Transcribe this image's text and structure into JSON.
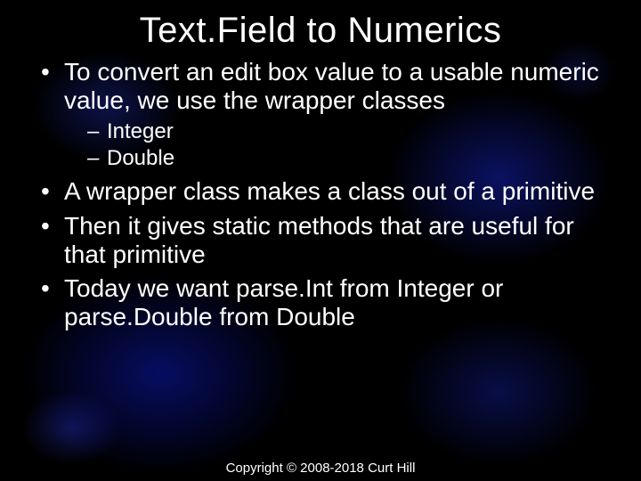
{
  "title": "Text.Field to Numerics",
  "bullets": {
    "b1": "To convert an edit box value to a usable numeric value, we use the wrapper classes",
    "b1_sub": {
      "s1": "Integer",
      "s2": "Double"
    },
    "b2": "A wrapper class makes a class out of a primitive",
    "b3": "Then it gives static methods that are useful for that primitive",
    "b4": "Today we want parse.Int from Integer or parse.Double from Double"
  },
  "footer": "Copyright © 2008-2018 Curt Hill"
}
